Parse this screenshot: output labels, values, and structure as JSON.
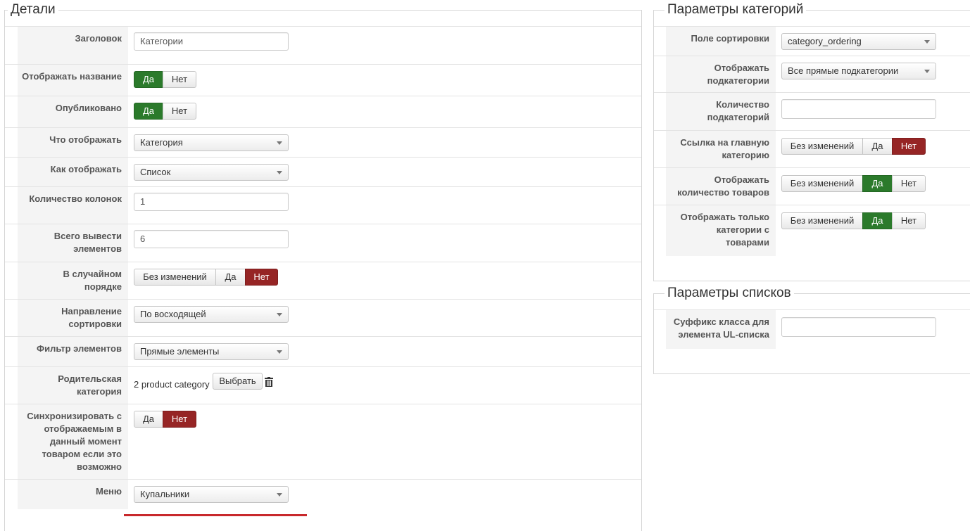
{
  "details": {
    "legend": "Детали",
    "title_label": "Заголовок",
    "title_value": "Категории",
    "show_title_label": "Отображать название",
    "published_label": "Опубликовано",
    "what_label": "Что отображать",
    "what_value": "Категория",
    "how_label": "Как отображать",
    "how_value": "Список",
    "columns_label": "Количество колонок",
    "columns_value": "1",
    "total_label": "Всего вывести элементов",
    "total_value": "6",
    "random_label": "В случайном порядке",
    "direction_label": "Направление сортировки",
    "direction_value": "По восходящей",
    "filter_label": "Фильтр элементов",
    "filter_value": "Прямые элементы",
    "parent_label": "Родительская категория",
    "parent_value": "2 product category",
    "parent_select": "Выбрать",
    "sync_label": "Синхронизировать с отображаемым в данный момент товаром если это возможно",
    "menu_label": "Меню",
    "menu_value": "Купальники"
  },
  "category_params": {
    "legend": "Параметры категорий",
    "sort_label": "Поле сортировки",
    "sort_value": "category_ordering",
    "show_sub_label": "Отображать подкатегории",
    "show_sub_value": "Все прямые подкатегории",
    "sub_count_label": "Количество подкатегорий",
    "sub_count_value": "",
    "main_link_label": "Ссылка на главную категорию",
    "show_count_label": "Отображать количество товаров",
    "only_with_label": "Отображать только категории с товарами"
  },
  "list_params": {
    "legend": "Параметры списков",
    "suffix_label": "Суффикс класса для элемента UL-списка",
    "suffix_value": ""
  },
  "toggles": {
    "yes": "Да",
    "no": "Нет",
    "no_change": "Без изменений"
  },
  "colors": {
    "active_green": "#2b7a2b",
    "active_red": "#962525",
    "underline_red": "#c8282c"
  }
}
